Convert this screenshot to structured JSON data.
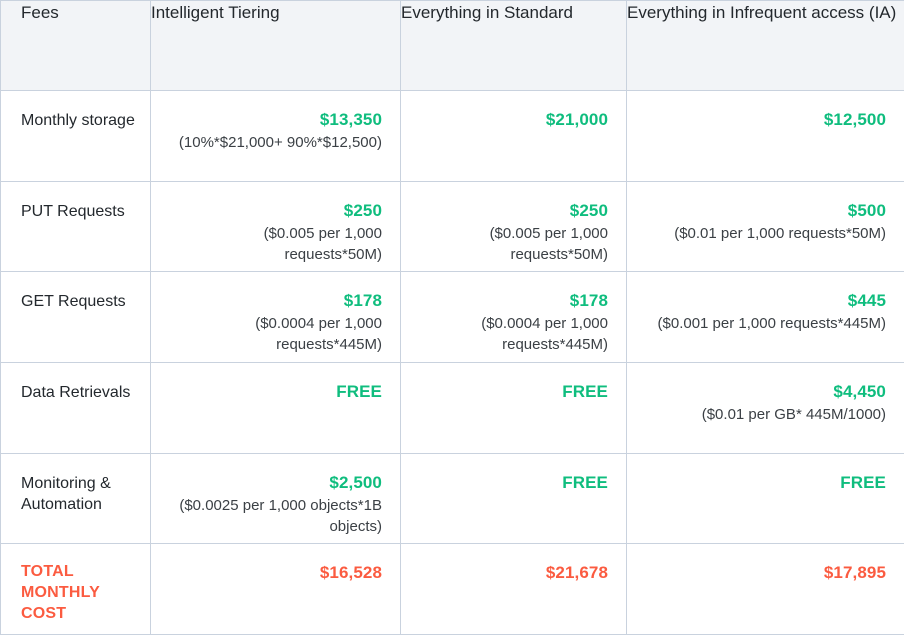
{
  "table": {
    "columns": [
      {
        "key": "fees",
        "label": "Fees"
      },
      {
        "key": "it",
        "label": "Intelligent Tiering"
      },
      {
        "key": "standard",
        "label": "Everything in Standard"
      },
      {
        "key": "ia",
        "label": "Everything in Infrequent access (IA)"
      }
    ],
    "colors": {
      "amount_green": "#0FBD7E",
      "total_orange": "#FB5B40",
      "header_bg": "#F2F4F7",
      "border": "#C9D2DE",
      "text": "#23282D"
    },
    "rows": [
      {
        "label": "Monthly storage",
        "cells": [
          {
            "amount": "$13,350",
            "detail": "(10%*$21,000+ 90%*$12,500)"
          },
          {
            "amount": "$21,000",
            "detail": ""
          },
          {
            "amount": "$12,500",
            "detail": ""
          }
        ]
      },
      {
        "label": "PUT Requests",
        "cells": [
          {
            "amount": "$250",
            "detail": "($0.005 per 1,000 requests*50M)"
          },
          {
            "amount": "$250",
            "detail": "($0.005 per 1,000 requests*50M)"
          },
          {
            "amount": "$500",
            "detail": "($0.01 per 1,000 requests*50M)"
          }
        ]
      },
      {
        "label": "GET Requests",
        "cells": [
          {
            "amount": "$178",
            "detail": "($0.0004 per 1,000 requests*445M)"
          },
          {
            "amount": "$178",
            "detail": "($0.0004 per 1,000 requests*445M)"
          },
          {
            "amount": "$445",
            "detail": "($0.001 per 1,000 requests*445M)"
          }
        ]
      },
      {
        "label": "Data Retrievals",
        "cells": [
          {
            "amount": "FREE",
            "detail": ""
          },
          {
            "amount": "FREE",
            "detail": ""
          },
          {
            "amount": "$4,450",
            "detail": "($0.01 per GB* 445M/1000)"
          }
        ]
      },
      {
        "label": "Monitoring & Automation",
        "cells": [
          {
            "amount": "$2,500",
            "detail": "($0.0025 per 1,000 objects*1B objects)"
          },
          {
            "amount": "FREE",
            "detail": ""
          },
          {
            "amount": "FREE",
            "detail": ""
          }
        ]
      }
    ],
    "total_row": {
      "label": "TOTAL MONTHLY COST",
      "cells": [
        {
          "amount": "$16,528",
          "detail": ""
        },
        {
          "amount": "$21,678",
          "detail": ""
        },
        {
          "amount": "$17,895",
          "detail": ""
        }
      ]
    }
  }
}
